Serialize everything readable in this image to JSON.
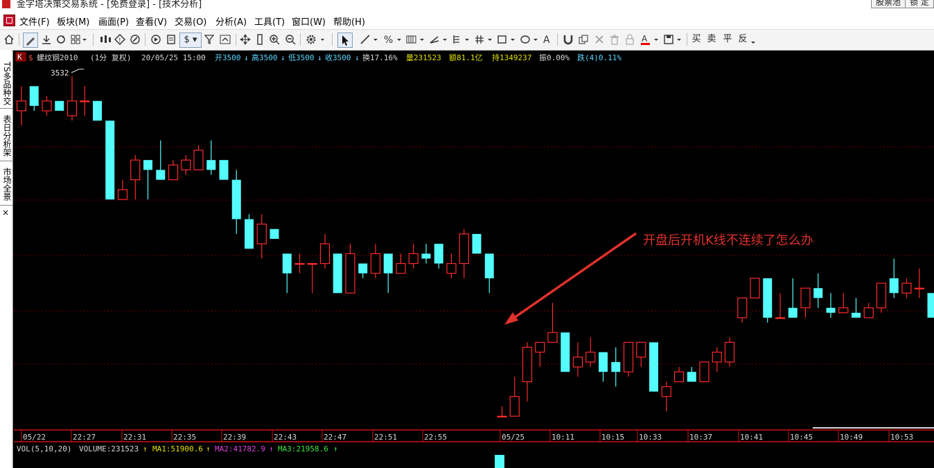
{
  "window": {
    "title": "金字塔决策交易系统 - [免费登录] - [技术分析]",
    "right_buttons": [
      "股票池",
      "锁 定"
    ]
  },
  "menu": [
    "文件(F)",
    "板块(M)",
    "画面(P)",
    "查看(V)",
    "交易(O)",
    "分析(A)",
    "工具(T)",
    "窗口(W)",
    "帮助(H)"
  ],
  "toolbar": {
    "icons": [
      "home-icon",
      "pencil-icon",
      "download-icon",
      "refresh-icon",
      "grid-icon",
      "candles-icon",
      "diamond-icon",
      "edit-icon",
      "play-icon",
      "doc-icon",
      "dollar-icon",
      "filter-icon",
      "export-icon",
      "move-icon",
      "ruler-icon",
      "zoom-in-icon",
      "zoom-out-icon",
      "gear-icon",
      "cursor-icon",
      "line-icon",
      "percent-icon",
      "period-icon",
      "fork-icon",
      "channel-icon",
      "hash-icon",
      "rect-icon",
      "ellipse-icon",
      "text-icon",
      "magnet-icon",
      "copy-icon",
      "delete-icon",
      "trash-icon",
      "lock-icon",
      "pen-color-icon",
      "save-icon"
    ],
    "trade_labels": [
      "买",
      "卖",
      "平",
      "反"
    ],
    "dollar": "$"
  },
  "sidebar": {
    "tabs": [
      "TS多品种交",
      "表日分析架",
      "市场全景"
    ],
    "close": "×"
  },
  "chart_header": {
    "tag": "K",
    "symbol": "螺纹钢2010",
    "period": "(1分 复权)",
    "datetime": "20/05/25 15:00",
    "open": "开3500",
    "high": "高3500",
    "low": "低3500",
    "close": "收3500",
    "turnover": "换17.16%",
    "volume": "量231523",
    "amount": "额81.1亿",
    "open_interest": "持1349237",
    "amplitude": "振0.00%",
    "change": "跌(4)0.11%"
  },
  "volume_header": {
    "label": "VOL(5,10,20)",
    "volume": "VOLUME:231523",
    "ma1": "MA1:51900.6",
    "ma2": "MA2:41782.9",
    "ma3": "MA3:21958.6"
  },
  "annotation": "开盘后开机K线不连续了怎么办",
  "high_marker": "3532",
  "time_axis": [
    "05/22",
    "22:27",
    "22:31",
    "22:35",
    "22:39",
    "22:43",
    "22:47",
    "22:51",
    "22:55",
    "05/25",
    "10:11",
    "10:15",
    "10:33",
    "10:37",
    "10:41",
    "10:45",
    "10:49",
    "10:53"
  ],
  "chart_data": {
    "type": "candlestick",
    "symbol": "螺纹钢2010",
    "period": "1分",
    "ylim": [
      3496.6,
      3533
    ],
    "highest_label": 3532,
    "colors": {
      "up": "#ff2a2a",
      "down": "#54fcfc",
      "grid": "#7a0000",
      "axis": "#cc1010"
    },
    "candles": [
      {
        "o": 3528.5,
        "h": 3531,
        "l": 3527,
        "c": 3529.5
      },
      {
        "o": 3531,
        "h": 3531,
        "l": 3528.5,
        "c": 3529
      },
      {
        "o": 3528.5,
        "h": 3530,
        "l": 3528,
        "c": 3529.5
      },
      {
        "o": 3529.5,
        "h": 3529.5,
        "l": 3528.5,
        "c": 3528.5
      },
      {
        "o": 3528,
        "h": 3532,
        "l": 3527.5,
        "c": 3529.5
      },
      {
        "o": 3529.5,
        "h": 3531,
        "l": 3528,
        "c": 3529.5
      },
      {
        "o": 3529.5,
        "h": 3529.5,
        "l": 3527.5,
        "c": 3527.5
      },
      {
        "o": 3527.5,
        "h": 3527.5,
        "l": 3519.5,
        "c": 3519.5
      },
      {
        "o": 3519.5,
        "h": 3521.5,
        "l": 3519.5,
        "c": 3520.5
      },
      {
        "o": 3521.5,
        "h": 3524,
        "l": 3519.5,
        "c": 3523.5
      },
      {
        "o": 3523.5,
        "h": 3523.5,
        "l": 3519.5,
        "c": 3522.5
      },
      {
        "o": 3522.5,
        "h": 3525.5,
        "l": 3521.5,
        "c": 3521.5
      },
      {
        "o": 3521.5,
        "h": 3523.5,
        "l": 3521.5,
        "c": 3523
      },
      {
        "o": 3522.5,
        "h": 3524,
        "l": 3522,
        "c": 3523.5
      },
      {
        "o": 3522.5,
        "h": 3525,
        "l": 3522.5,
        "c": 3524.5
      },
      {
        "o": 3523.5,
        "h": 3525.5,
        "l": 3522,
        "c": 3522.5
      },
      {
        "o": 3523.5,
        "h": 3523.5,
        "l": 3521.5,
        "c": 3521.5
      },
      {
        "o": 3521.5,
        "h": 3522.5,
        "l": 3516,
        "c": 3517.5
      },
      {
        "o": 3517.5,
        "h": 3518,
        "l": 3514.5,
        "c": 3514.5
      },
      {
        "o": 3515,
        "h": 3518,
        "l": 3513.5,
        "c": 3517
      },
      {
        "o": 3516.5,
        "h": 3516.5,
        "l": 3515.5,
        "c": 3515.5
      },
      {
        "o": 3514,
        "h": 3514,
        "l": 3510,
        "c": 3512
      },
      {
        "o": 3513,
        "h": 3514,
        "l": 3512,
        "c": 3513
      },
      {
        "o": 3513,
        "h": 3513,
        "l": 3510,
        "c": 3513
      },
      {
        "o": 3513,
        "h": 3516,
        "l": 3512.5,
        "c": 3515
      },
      {
        "o": 3514,
        "h": 3514,
        "l": 3510,
        "c": 3510
      },
      {
        "o": 3510,
        "h": 3515,
        "l": 3510,
        "c": 3514
      },
      {
        "o": 3513,
        "h": 3513,
        "l": 3511.5,
        "c": 3512
      },
      {
        "o": 3512,
        "h": 3515,
        "l": 3511.5,
        "c": 3514
      },
      {
        "o": 3514,
        "h": 3514,
        "l": 3510,
        "c": 3512
      },
      {
        "o": 3512,
        "h": 3514,
        "l": 3512,
        "c": 3513
      },
      {
        "o": 3513,
        "h": 3515,
        "l": 3512.5,
        "c": 3514
      },
      {
        "o": 3514,
        "h": 3515,
        "l": 3513,
        "c": 3513.5
      },
      {
        "o": 3515,
        "h": 3515,
        "l": 3512.5,
        "c": 3513
      },
      {
        "o": 3512,
        "h": 3514,
        "l": 3511.5,
        "c": 3513
      },
      {
        "o": 3513,
        "h": 3516.5,
        "l": 3511.5,
        "c": 3516
      },
      {
        "o": 3516,
        "h": 3516,
        "l": 3514,
        "c": 3514
      },
      {
        "o": 3514,
        "h": 3514,
        "l": 3510,
        "c": 3511.5
      },
      {
        "o": 3497.5,
        "h": 3498.5,
        "l": 3497.5,
        "c": 3497.5
      },
      {
        "o": 3497.5,
        "h": 3501.5,
        "l": 3497.5,
        "c": 3499.5
      },
      {
        "o": 3501,
        "h": 3505,
        "l": 3499,
        "c": 3504.5
      },
      {
        "o": 3504,
        "h": 3505,
        "l": 3502.5,
        "c": 3505
      },
      {
        "o": 3505,
        "h": 3509,
        "l": 3505,
        "c": 3506
      },
      {
        "o": 3506,
        "h": 3506,
        "l": 3502,
        "c": 3502
      },
      {
        "o": 3502.5,
        "h": 3505,
        "l": 3501.5,
        "c": 3503.5
      },
      {
        "o": 3503,
        "h": 3505.5,
        "l": 3502.5,
        "c": 3504
      },
      {
        "o": 3504,
        "h": 3504,
        "l": 3501,
        "c": 3502
      },
      {
        "o": 3503,
        "h": 3504.5,
        "l": 3500.5,
        "c": 3502
      },
      {
        "o": 3502,
        "h": 3505,
        "l": 3501.5,
        "c": 3505
      },
      {
        "o": 3503.5,
        "h": 3505,
        "l": 3502.5,
        "c": 3505
      },
      {
        "o": 3505,
        "h": 3505,
        "l": 3500,
        "c": 3500
      },
      {
        "o": 3499.5,
        "h": 3501,
        "l": 3498,
        "c": 3500.5
      },
      {
        "o": 3501,
        "h": 3502.5,
        "l": 3501,
        "c": 3502
      },
      {
        "o": 3502,
        "h": 3502.5,
        "l": 3501,
        "c": 3501
      },
      {
        "o": 3501,
        "h": 3503,
        "l": 3501,
        "c": 3503
      },
      {
        "o": 3503,
        "h": 3504.5,
        "l": 3502,
        "c": 3504
      },
      {
        "o": 3503,
        "h": 3505.5,
        "l": 3502.5,
        "c": 3505
      },
      {
        "o": 3507.5,
        "h": 3509.5,
        "l": 3507,
        "c": 3509.5
      },
      {
        "o": 3509.5,
        "h": 3511,
        "l": 3509.5,
        "c": 3511.5
      },
      {
        "o": 3511.5,
        "h": 3511.5,
        "l": 3507,
        "c": 3507.5
      },
      {
        "o": 3507.5,
        "h": 3510,
        "l": 3507.5,
        "c": 3507.5
      },
      {
        "o": 3508.5,
        "h": 3511.5,
        "l": 3507.5,
        "c": 3507.5
      },
      {
        "o": 3508.5,
        "h": 3510.5,
        "l": 3507.5,
        "c": 3510.5
      },
      {
        "o": 3510.5,
        "h": 3512,
        "l": 3508.5,
        "c": 3509.5
      },
      {
        "o": 3508.5,
        "h": 3510,
        "l": 3507.5,
        "c": 3508
      },
      {
        "o": 3508,
        "h": 3510,
        "l": 3508,
        "c": 3508.5
      },
      {
        "o": 3508,
        "h": 3509.5,
        "l": 3507.5,
        "c": 3507.5
      },
      {
        "o": 3507.5,
        "h": 3509,
        "l": 3507.5,
        "c": 3508.5
      },
      {
        "o": 3508.5,
        "h": 3511,
        "l": 3508,
        "c": 3511
      },
      {
        "o": 3511.5,
        "h": 3513.5,
        "l": 3509.5,
        "c": 3510
      },
      {
        "o": 3510,
        "h": 3511.5,
        "l": 3509.5,
        "c": 3511
      },
      {
        "o": 3510.5,
        "h": 3512.5,
        "l": 3509.5,
        "c": 3510.5
      },
      {
        "o": 3510,
        "h": 3510,
        "l": 3507.5,
        "c": 3507.5
      }
    ],
    "gap_after_index": 37,
    "volume_last_bar": "tall cyan bar at the 05/25 session open"
  }
}
